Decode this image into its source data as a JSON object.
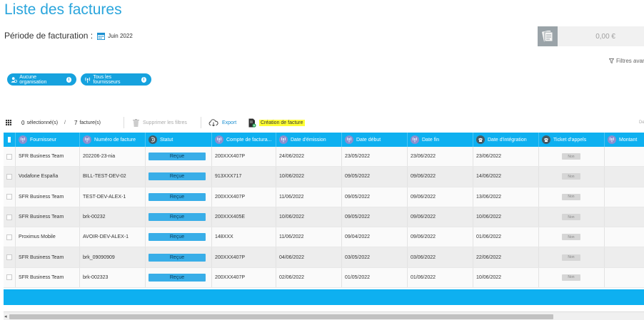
{
  "page": {
    "title": "Liste des factures"
  },
  "period": {
    "label": "Période de facturation :",
    "value": "Juin 2022"
  },
  "total": {
    "value": "0,00 €"
  },
  "filters": {
    "advanced_label": "Filtres avan",
    "organization_label": "Aucune organisation",
    "suppliers_label": "Tous les fournisseurs"
  },
  "toolbar": {
    "selected_count": "0",
    "selected_label": "sélectionné(s)",
    "separator": "/",
    "total_count": "7",
    "total_label": "facture(s)",
    "delete_filters_label": "Supprimer les filtres",
    "export_label": "Export",
    "create_label": "Création de facture",
    "right_fragment": "De"
  },
  "columns": [
    "Fournisseur",
    "Numéro de facture",
    "Statut",
    "Compte de factura...",
    "Date d'émission",
    "Date début",
    "Date fin",
    "Date d'intégration",
    "Ticket d'appels",
    "Montant"
  ],
  "rows": [
    {
      "fournisseur": "SFR Business Team",
      "numero": "202206-23-nia",
      "statut": "Reçue",
      "compte": "200XXX407P",
      "emission": "24/06/2022",
      "debut": "23/05/2022",
      "fin": "23/06/2022",
      "integration": "23/06/2022",
      "ticket": "Non"
    },
    {
      "fournisseur": "Vodafone España",
      "numero": "BILL-TEST-DEV-02",
      "statut": "Reçue",
      "compte": "913XXX717",
      "emission": "10/06/2022",
      "debut": "09/05/2022",
      "fin": "09/06/2022",
      "integration": "14/06/2022",
      "ticket": "Non"
    },
    {
      "fournisseur": "SFR Business Team",
      "numero": "TEST-DEV-ALEX-1",
      "statut": "Reçue",
      "compte": "200XXX407P",
      "emission": "11/06/2022",
      "debut": "09/05/2022",
      "fin": "09/06/2022",
      "integration": "13/06/2022",
      "ticket": "Non"
    },
    {
      "fournisseur": "SFR Business Team",
      "numero": "brk-00232",
      "statut": "Reçue",
      "compte": "200XXX405E",
      "emission": "10/06/2022",
      "debut": "09/05/2022",
      "fin": "09/06/2022",
      "integration": "10/06/2022",
      "ticket": "Non"
    },
    {
      "fournisseur": "Proximus Mobile",
      "numero": "AVOIR-DEV-ALEX-1",
      "statut": "Reçue",
      "compte": "148XXX",
      "emission": "11/06/2022",
      "debut": "09/04/2022",
      "fin": "09/06/2022",
      "integration": "01/06/2022",
      "ticket": "Non"
    },
    {
      "fournisseur": "SFR Business Team",
      "numero": "brk_09090909",
      "statut": "Reçue",
      "compte": "200XXX407P",
      "emission": "04/06/2022",
      "debut": "03/05/2022",
      "fin": "03/06/2022",
      "integration": "22/06/2022",
      "ticket": "Non"
    },
    {
      "fournisseur": "SFR Business Team",
      "numero": "brk-002323",
      "statut": "Reçue",
      "compte": "200XXX407P",
      "emission": "02/06/2022",
      "debut": "01/05/2022",
      "fin": "01/06/2022",
      "integration": "10/06/2022",
      "ticket": "Non"
    }
  ],
  "icons": {
    "calendar": "calendar-icon",
    "receipt": "receipt-icon",
    "filter": "filter-icon",
    "grid": "grid-icon",
    "trash": "trash-icon",
    "cloud_export": "cloud-export-icon",
    "create_invoice": "invoice-add-icon"
  },
  "colors": {
    "accent": "#0eb0f0",
    "title": "#2aa5dc",
    "status": "#39aee8",
    "highlight": "#ffff33"
  }
}
